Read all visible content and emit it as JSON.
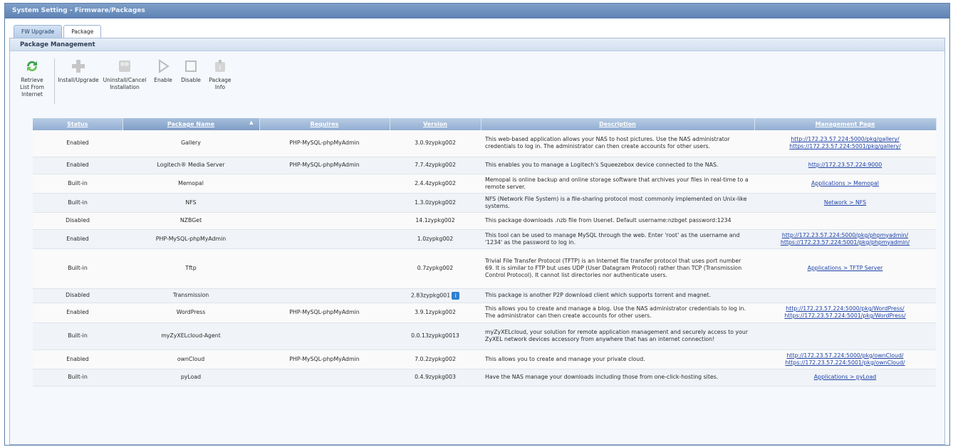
{
  "window": {
    "title": "System Setting - Firmware/Packages"
  },
  "tabs": [
    {
      "label": "FW Upgrade",
      "active": false
    },
    {
      "label": "Package",
      "active": true
    }
  ],
  "panel": {
    "title": "Package Management"
  },
  "toolbar": {
    "retrieve": "Retrieve List From Internet",
    "install": "Install/Upgrade",
    "uninstall": "Uninstall/Cancel Installation",
    "enable": "Enable",
    "disable": "Disable",
    "info": "Package Info"
  },
  "table": {
    "headers": [
      "Status",
      "Package Name",
      "Requires",
      "Version",
      "Description",
      "Management Page"
    ],
    "sorted_column": "Package Name",
    "rows": [
      {
        "status": "Enabled",
        "name": "Gallery",
        "requires": "PHP-MySQL-phpMyAdmin",
        "version": "3.0.9zypkg002",
        "description": "This web-based application allows your NAS to host pictures. Use the NAS administrator credentials to log in. The administrator can then create accounts for other users.",
        "links": [
          "http://172.23.57.224:5000/pkg/gallery/",
          "https://172.23.57.224:5001/pkg/gallery/"
        ]
      },
      {
        "status": "Enabled",
        "name": "Logitech® Media Server",
        "requires": "PHP-MySQL-phpMyAdmin",
        "version": "7.7.4zypkg002",
        "description": "This enables you to manage a Logitech's Squeezebox device connected to the NAS.",
        "links": [
          "http://172.23.57.224:9000"
        ]
      },
      {
        "status": "Built-in",
        "name": "Memopal",
        "requires": "",
        "version": "2.4.4zypkg002",
        "description": "Memopal is online backup and online storage software that archives your files in real-time to a remote server.",
        "links": [
          "Applications > Memopal"
        ]
      },
      {
        "status": "Built-in",
        "name": "NFS",
        "requires": "",
        "version": "1.3.0zypkg002",
        "description": "NFS (Network File System) is a file-sharing protocol most commonly implemented on Unix-like systems.",
        "links": [
          "Network > NFS"
        ]
      },
      {
        "status": "Disabled",
        "name": "NZBGet",
        "requires": "",
        "version": "14.1zypkg002",
        "description": "This package downloads .nzb file from Usenet. Default username:nzbget password:1234",
        "links": []
      },
      {
        "status": "Enabled",
        "name": "PHP-MySQL-phpMyAdmin",
        "requires": "",
        "version": "1.0zypkg002",
        "description": "This tool can be used to manage MySQL through the web. Enter 'root' as the username and '1234' as the password to log in.",
        "links": [
          "http://172.23.57.224:5000/pkg/phpmyadmin/",
          "https://172.23.57.224:5001/pkg/phpmyadmin/"
        ]
      },
      {
        "status": "Built-in",
        "name": "Tftp",
        "requires": "",
        "version": "0.7zypkg002",
        "description": "Trivial File Transfer Protocol (TFTP) is an Internet file transfer protocol that uses port number 69. It is similar to FTP but uses UDP (User Datagram Protocol) rather than TCP (Transmission Control Protocol). It cannot list directories nor authenticate users.",
        "links": [
          "Applications > TFTP Server"
        ]
      },
      {
        "status": "Disabled",
        "name": "Transmission",
        "requires": "",
        "version": "2.83zypkg001",
        "update_icon": true,
        "description": "This package is another P2P download client which supports torrent and magnet.",
        "links": []
      },
      {
        "status": "Enabled",
        "name": "WordPress",
        "requires": "PHP-MySQL-phpMyAdmin",
        "version": "3.9.1zypkg002",
        "description": "This allows you to create and manage a blog. Use the NAS administrator credentials to log in. The administrator can then create accounts for other users.",
        "links": [
          "http://172.23.57.224:5000/pkg/WordPress/",
          "https://172.23.57.224:5001/pkg/WordPress/"
        ]
      },
      {
        "status": "Built-in",
        "name": "myZyXELcloud-Agent",
        "requires": "",
        "version": "0.0.13zypkg0013",
        "description": "myZyXELcloud, your solution for remote application management and securely access to your ZyXEL network devices accessory from anywhere that has an internet connection!",
        "links": []
      },
      {
        "status": "Enabled",
        "name": "ownCloud",
        "requires": "PHP-MySQL-phpMyAdmin",
        "version": "7.0.2zypkg002",
        "description": "This allows you to create and manage your private cloud.",
        "links": [
          "http://172.23.57.224:5000/pkg/ownCloud/",
          "https://172.23.57.224:5001/pkg/ownCloud/"
        ]
      },
      {
        "status": "Built-in",
        "name": "pyLoad",
        "requires": "",
        "version": "0.4.9zypkg003",
        "description": "Have the NAS manage your downloads including those from one-click-hosting sites.",
        "links": [
          "Applications > pyLoad"
        ]
      }
    ]
  }
}
